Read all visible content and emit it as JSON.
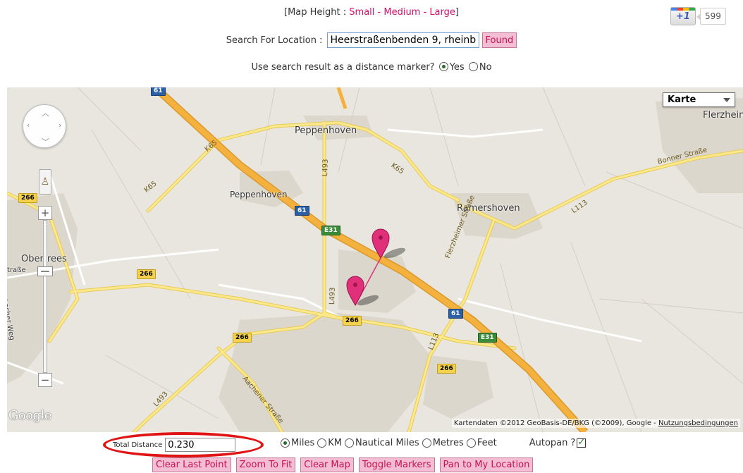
{
  "map_height": {
    "prefix": "[Map Height : ",
    "small": "Small",
    "dash1": " - ",
    "medium": "Medium",
    "dash2": " - ",
    "large": "Large",
    "suffix": "]"
  },
  "gplus": {
    "label": "+1",
    "count": "599"
  },
  "search": {
    "label": "Search For Location :",
    "value": "Heerstraßenbenden 9, rheinb",
    "button": "Found"
  },
  "marker_option": {
    "question": "Use search result as a distance marker?",
    "yes": "Yes",
    "no": "No",
    "selected": "yes"
  },
  "map": {
    "type_select": "Karte",
    "google_logo": "Google",
    "credits": "Kartendaten ©2012 GeoBasis-DE/BKG (©2009), Google - ",
    "terms": "Nutzungsbedingungen",
    "places": {
      "peppenhoven_large": "Peppenhoven",
      "peppenhoven_small": "Peppenhoven",
      "ramershoven": "Ramershoven",
      "flerzheim": "Flerzhein",
      "obertrees": "Obertrees",
      "strasse_left": "traße",
      "locher_weg": "Locher Weg",
      "bonner_strasse": "Bonner Straße",
      "flerzheimer_strasse": "Flerzheimer Straße",
      "aachener_strasse": "Aachener Straße"
    },
    "shields": {
      "a61_top": "61",
      "a61_mid": "61",
      "a61_low": "61",
      "e31_mid": "E31",
      "e31_low": "E31",
      "k65_a": "K65",
      "k65_b": "K65",
      "k65_c": "K65",
      "l493_a": "L493",
      "l493_b": "L493",
      "l493_c": "L493",
      "l113_a": "L113",
      "l113_b": "L113",
      "r266_a": "266",
      "r266_b": "266",
      "r266_c": "266",
      "r266_d": "266",
      "r266_e": "266"
    }
  },
  "distance": {
    "label": "Total Distance",
    "value": "0.230"
  },
  "units": {
    "miles": "Miles",
    "km": "KM",
    "nautical": "Nautical Miles",
    "metres": "Metres",
    "feet": "Feet",
    "selected": "miles"
  },
  "autopan": {
    "label": "Autopan ?",
    "checked": true
  },
  "actions": {
    "clear_last": "Clear Last Point",
    "zoom_fit": "Zoom To Fit",
    "clear_map": "Clear Map",
    "toggle_markers": "Toggle Markers",
    "pan_location": "Pan to My Location"
  },
  "colors": {
    "link_pink": "#d0106a",
    "button_bg": "#f3bdd4",
    "button_text": "#c8124f",
    "highlight_oval": "#e01414",
    "motorway": "#f4b13e",
    "road_yellow": "#fbe98a",
    "marker": "#e0307a"
  }
}
